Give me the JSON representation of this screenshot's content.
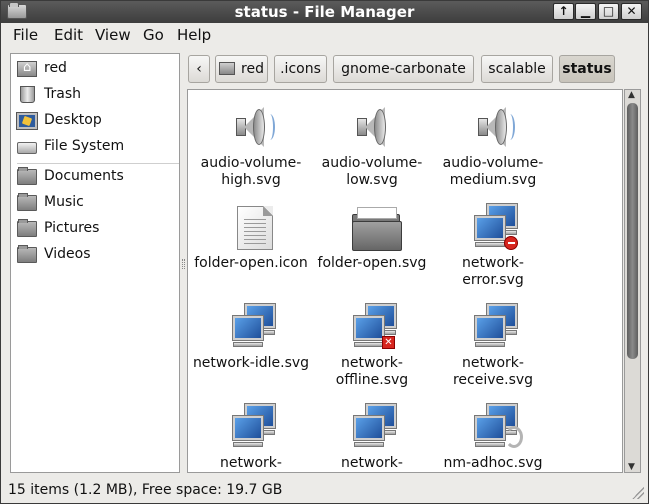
{
  "window": {
    "title": "status - File Manager"
  },
  "menu": [
    "File",
    "Edit",
    "View",
    "Go",
    "Help"
  ],
  "sidebar": {
    "places": [
      {
        "label": "red",
        "icon": "home-folder-icon"
      },
      {
        "label": "Trash",
        "icon": "trash-icon"
      },
      {
        "label": "Desktop",
        "icon": "desktop-icon"
      },
      {
        "label": "File System",
        "icon": "drive-icon"
      }
    ],
    "bookmarks": [
      {
        "label": "Documents",
        "icon": "folder-icon"
      },
      {
        "label": "Music",
        "icon": "folder-icon"
      },
      {
        "label": "Pictures",
        "icon": "folder-icon"
      },
      {
        "label": "Videos",
        "icon": "folder-icon"
      }
    ]
  },
  "pathbar": {
    "back": "‹",
    "segments": [
      "red",
      ".icons",
      "gnome-carbonate",
      "scalable",
      "status"
    ],
    "active": "status"
  },
  "files": [
    {
      "name": "audio-volume-high.svg",
      "line1": "audio-volume-",
      "line2": "high.svg",
      "icon": "speaker-icon"
    },
    {
      "name": "audio-volume-low.svg",
      "line1": "audio-volume-",
      "line2": "low.svg",
      "icon": "speaker-icon"
    },
    {
      "name": "audio-volume-medium.svg",
      "line1": "audio-volume-",
      "line2": "medium.svg",
      "icon": "speaker-icon"
    },
    {
      "name": "folder-open.icon",
      "line1": "folder-open.icon",
      "line2": "",
      "icon": "text-document-icon"
    },
    {
      "name": "folder-open.svg",
      "line1": "folder-open.svg",
      "line2": "",
      "icon": "open-folder-icon"
    },
    {
      "name": "network-error.svg",
      "line1": "network-",
      "line2": "error.svg",
      "icon": "network-error-icon"
    },
    {
      "name": "network-idle.svg",
      "line1": "network-idle.svg",
      "line2": "",
      "icon": "network-icon"
    },
    {
      "name": "network-offline.svg",
      "line1": "network-",
      "line2": "offline.svg",
      "icon": "network-offline-icon"
    },
    {
      "name": "network-receive.svg",
      "line1": "network-",
      "line2": "receive.svg",
      "icon": "network-icon"
    },
    {
      "name": "network-…",
      "line1": "network-",
      "line2": "",
      "icon": "network-icon"
    },
    {
      "name": "network-…",
      "line1": "network-",
      "line2": "",
      "icon": "network-icon"
    },
    {
      "name": "nm-adhoc.svg",
      "line1": "nm-adhoc.svg",
      "line2": "",
      "icon": "network-adhoc-icon"
    }
  ],
  "status": "15 items (1.2 MB), Free space: 19.7 GB"
}
